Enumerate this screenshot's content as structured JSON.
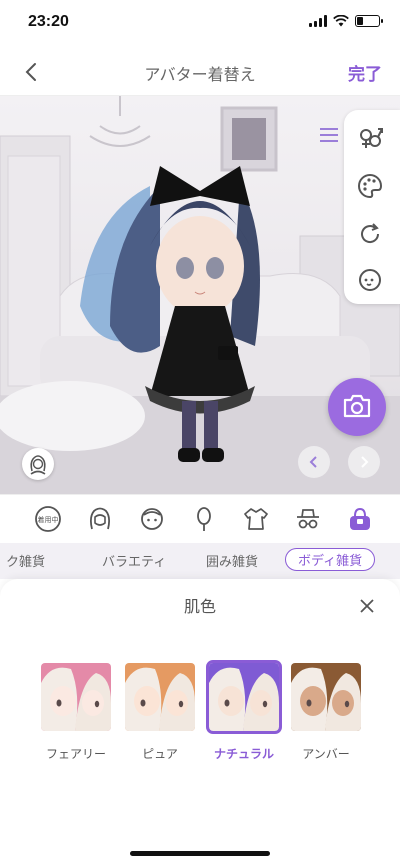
{
  "status_bar": {
    "time": "23:20",
    "battery_level": 0.3
  },
  "nav": {
    "title": "アバター着替え",
    "done_label": "完了"
  },
  "categories": [
    {
      "name": "wearing-badge",
      "text": "着用中"
    },
    {
      "name": "hair"
    },
    {
      "name": "face"
    },
    {
      "name": "accessory"
    },
    {
      "name": "clothes"
    },
    {
      "name": "hat-glasses"
    },
    {
      "name": "bag",
      "active": true
    }
  ],
  "subtabs": {
    "items": [
      "ク雑貨",
      "バラエティ",
      "囲み雑貨",
      "ボディ雑貨"
    ],
    "active_index": 3
  },
  "sheet": {
    "title": "肌色",
    "options": [
      {
        "label": "フェアリー",
        "bg": "#e48aa8",
        "skin": "#fbe9e2"
      },
      {
        "label": "ピュア",
        "bg": "#e59a62",
        "skin": "#fbe4d6"
      },
      {
        "label": "ナチュラル",
        "bg": "#7f5bd4",
        "skin": "#f7e3d6",
        "selected": true
      },
      {
        "label": "アンバー",
        "bg": "#8a5a34",
        "skin": "#d9a98a"
      }
    ]
  },
  "colors": {
    "accent": "#8a5cd6",
    "camera": "#9b6be0"
  }
}
